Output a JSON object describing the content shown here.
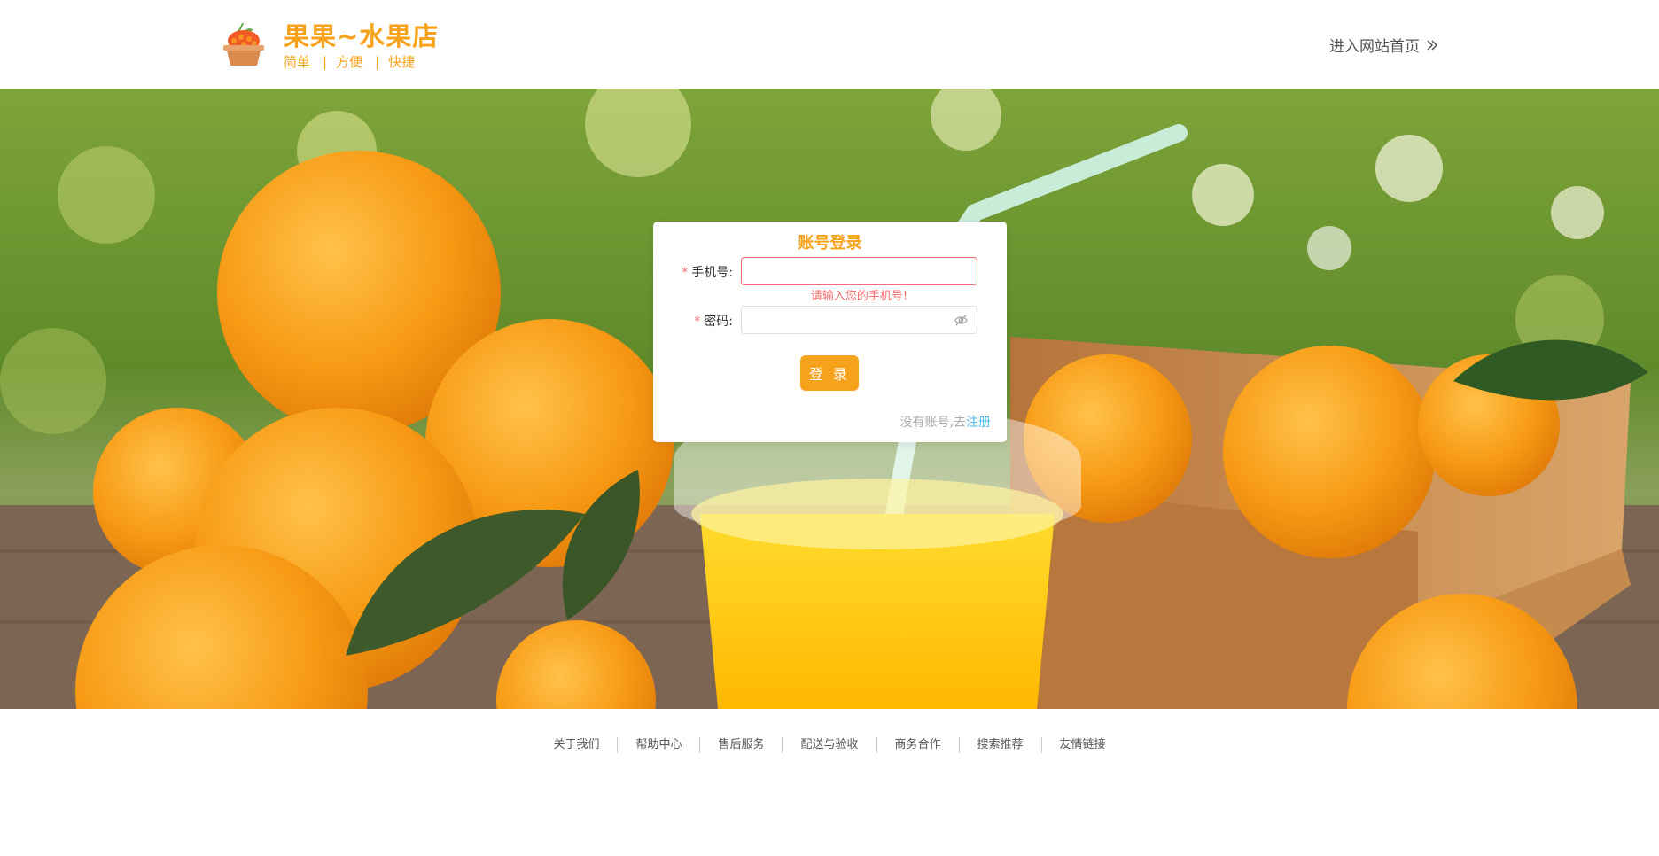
{
  "header": {
    "title": "果果~水果店",
    "slogan": [
      "简单",
      "方便",
      "快捷"
    ],
    "slogan_sep": "|",
    "home_link": "进入网站首页"
  },
  "login": {
    "title": "账号登录",
    "phone_label": "手机号:",
    "phone_value": "",
    "phone_error": "请输入您的手机号!",
    "password_label": "密码:",
    "password_value": "",
    "required_mark": "*",
    "submit_label": "登 录",
    "register_prompt": "没有账号,去",
    "register_link": "注册"
  },
  "footer": {
    "links": [
      "关于我们",
      "帮助中心",
      "售后服务",
      "配送与验收",
      "商务合作",
      "搜索推荐",
      "友情链接"
    ]
  },
  "colors": {
    "brand": "#f7a21b",
    "error": "#f56c6c",
    "link": "#4cb8e9"
  }
}
